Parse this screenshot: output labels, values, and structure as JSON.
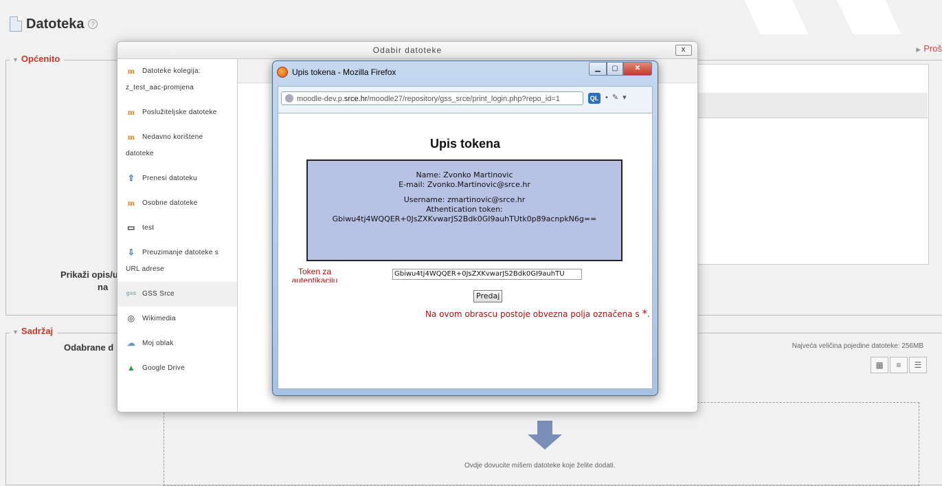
{
  "page": {
    "title": "Datoteka",
    "expand_all": "Proš",
    "sections": {
      "general": "Općenito",
      "content": "Sadržaj"
    },
    "labels": {
      "show_description_a": "Prikaži opis/u",
      "show_description_b": "na",
      "selected_files": "Odabrane d"
    },
    "max_file_size": "Najveća veličina pojedine datoteke: 256MB",
    "drop_hint": "Ovdje dovucite mišem datoteke koje želite dodati."
  },
  "picker": {
    "title": "Odabir datoteke",
    "close": "x",
    "repositories": [
      {
        "label": "Datoteke kolegija: z_test_aac-promjena",
        "icon": "moodle-icon",
        "glyph": "m"
      },
      {
        "label": "Poslužiteljske datoteke",
        "icon": "moodle-icon",
        "glyph": "m"
      },
      {
        "label": "Nedavno korištene datoteke",
        "icon": "moodle-icon",
        "glyph": "m"
      },
      {
        "label": "Prenesi datoteku",
        "icon": "upload-icon",
        "glyph": "⇪"
      },
      {
        "label": "Osobne datoteke",
        "icon": "moodle-icon",
        "glyph": "m"
      },
      {
        "label": "test",
        "icon": "folder-icon",
        "glyph": "▭"
      },
      {
        "label": "Preuzimanje datoteke s URL adrese",
        "icon": "download-icon",
        "glyph": "⇩"
      },
      {
        "label": "GSS Srce",
        "icon": "gss-icon",
        "glyph": "gss"
      },
      {
        "label": "Wikimedia",
        "icon": "wikimedia-icon",
        "glyph": "◎"
      },
      {
        "label": "Moj oblak",
        "icon": "cloud-icon",
        "glyph": "☁"
      },
      {
        "label": "Google Drive",
        "icon": "google-drive-icon",
        "glyph": "▲"
      }
    ]
  },
  "browser": {
    "title": "Upis tokena - Mozilla Firefox",
    "url_prefix": "moodle-dev.p.",
    "url_host": "srce.hr",
    "url_suffix": "/moodle27/repository/gss_srce/print_login.php?repo_id=1",
    "ql_badge": "QL"
  },
  "token_form": {
    "heading": "Upis tokena",
    "name_line": "Name: Zvonko Martinovic",
    "email_line": "E-mail: Zvonko.Martinovic@srce.hr",
    "username_line": "Username: zmartinovic@srce.hr",
    "token_label_line": "Athentication token:",
    "token_value": "Gbiwu4tj4WQQER+0JsZXKvwarJS2Bdk0GI9auhTUtk0p89acnpkN6g==",
    "field_label": "Token za autentikaciju",
    "field_value": "Gbiwu4tj4WQQER+0JsZXKvwarJS2Bdk0GI9auhTU",
    "submit": "Predaj",
    "required_note": "Na ovom obrascu postoje obvezna polja označena s",
    "required_star": "*",
    "required_end": "."
  }
}
